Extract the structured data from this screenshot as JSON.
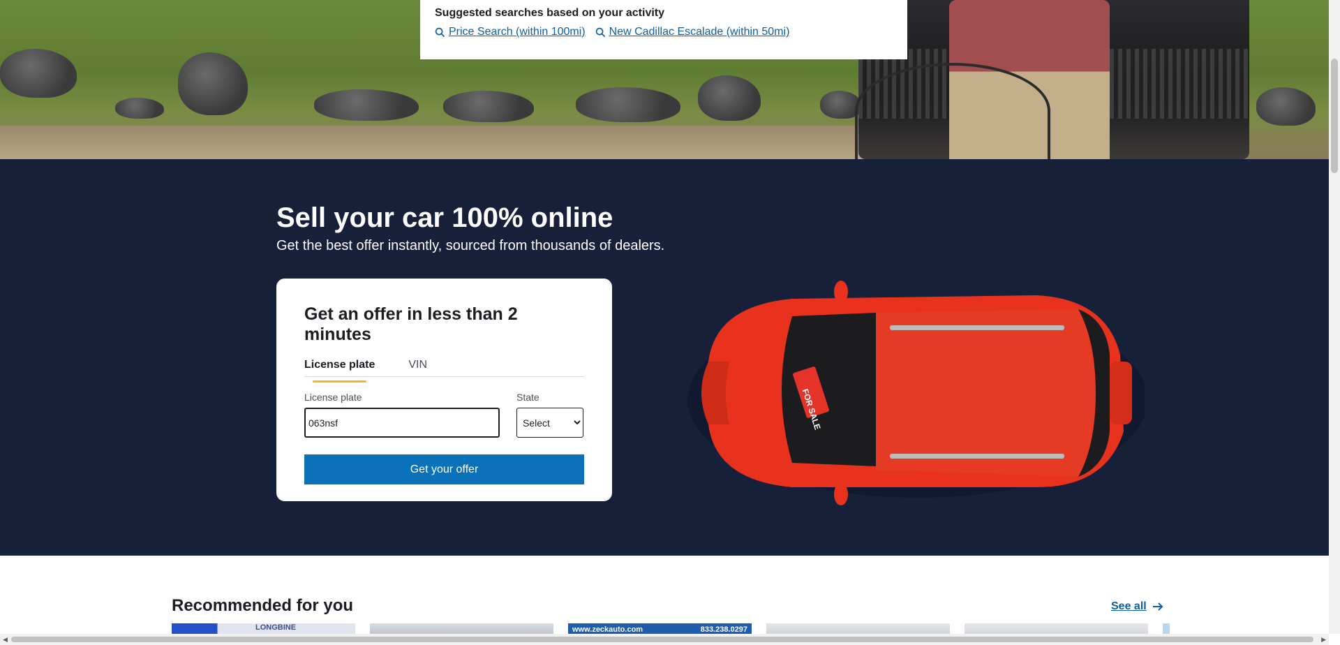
{
  "suggestions": {
    "title": "Suggested searches based on your activity",
    "items": [
      {
        "label": "Price Search (within 100mi)"
      },
      {
        "label": "New Cadillac Escalade (within 50mi)"
      }
    ]
  },
  "sell": {
    "title": "Sell your car 100% online",
    "subtitle": "Get the best offer instantly, sourced from thousands of dealers.",
    "card": {
      "title": "Get an offer in less than 2 minutes",
      "tabs": [
        {
          "label": "License plate",
          "active": true
        },
        {
          "label": "VIN",
          "active": false
        }
      ],
      "plate_label": "License plate",
      "plate_value": "063nsf",
      "state_label": "State",
      "state_selected": "Select",
      "submit_label": "Get your offer"
    },
    "car_sign": "FOR SALE"
  },
  "recommended": {
    "title": "Recommended for you",
    "see_all": "See all",
    "thumbs": [
      {
        "text": "LONGBINE"
      },
      {
        "text": ""
      },
      {
        "text_left": "www.zeckauto.com",
        "text_right": "833.238.0297"
      },
      {
        "text": ""
      },
      {
        "text": ""
      }
    ]
  },
  "colors": {
    "navy": "#162039",
    "accent_blue": "#0b71b9",
    "link_blue": "#0b5fa5",
    "tab_underline": "#f5b521",
    "car_red": "#e8321e"
  }
}
